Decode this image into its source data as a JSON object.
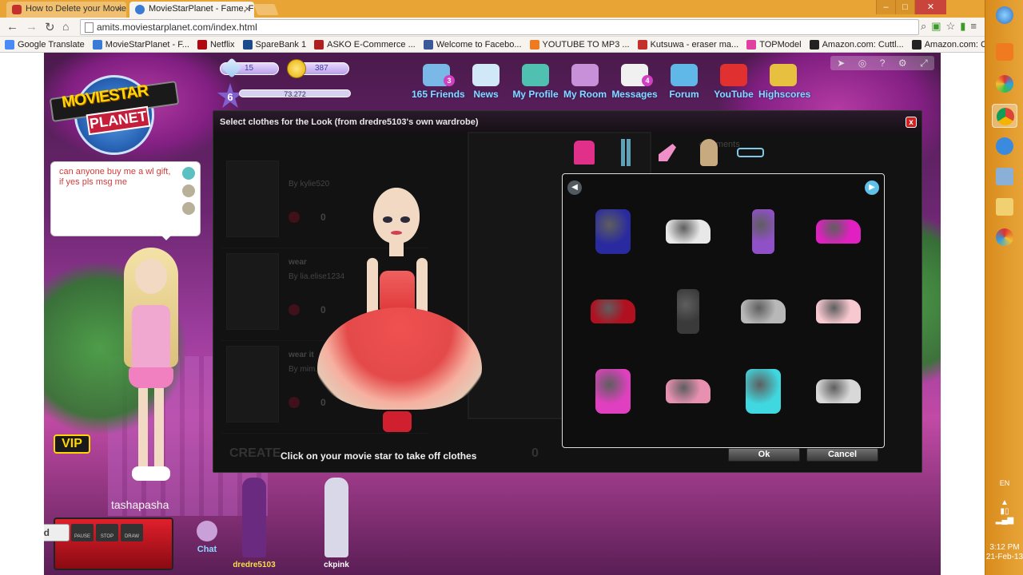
{
  "browser": {
    "tabs": [
      {
        "title": "How to Delete your Movie",
        "favicon_color": "#c4302b"
      },
      {
        "title": "MovieStarPlanet - Fame, F",
        "favicon_color": "#3a7bd5"
      }
    ],
    "url": "amits.moviestarplanet.com/index.html",
    "bookmarks": [
      {
        "label": "Google Translate",
        "color": "#4a8af4"
      },
      {
        "label": "MovieStarPlanet - F...",
        "color": "#3a7bd5"
      },
      {
        "label": "Netflix",
        "color": "#b00710"
      },
      {
        "label": "SpareBank 1",
        "color": "#1a4a8a"
      },
      {
        "label": "ASKO E-Commerce ...",
        "color": "#b02020"
      },
      {
        "label": "Welcome to Facebo...",
        "color": "#3b5998"
      },
      {
        "label": "YOUTUBE TO MP3 ...",
        "color": "#f07a20"
      },
      {
        "label": "Kutsuwa - eraser ma...",
        "color": "#c4302b"
      },
      {
        "label": "TOPModel",
        "color": "#e040a0"
      },
      {
        "label": "Amazon.com: Cuttl...",
        "color": "#222222"
      },
      {
        "label": "Amazon.com: Cuttl...",
        "color": "#222222"
      }
    ]
  },
  "game": {
    "logo": {
      "line1": "MOVIESTAR",
      "line2": "PLANET"
    },
    "stats": {
      "diamonds": "15",
      "starcoins": "387",
      "level": "6",
      "fame": "73.272"
    },
    "nav": [
      {
        "label": "165 Friends",
        "badge": "3",
        "color": "#7ab8e8"
      },
      {
        "label": "News",
        "badge": "",
        "color": "#d0e8f8"
      },
      {
        "label": "My Profile",
        "badge": "",
        "color": "#50c0b0"
      },
      {
        "label": "My Room",
        "badge": "",
        "color": "#c890d8"
      },
      {
        "label": "Messages",
        "badge": "4",
        "color": "#f0f0f0"
      },
      {
        "label": "Forum",
        "badge": "",
        "color": "#60b8e8"
      },
      {
        "label": "YouTube",
        "badge": "",
        "color": "#e03030"
      },
      {
        "label": "Highscores",
        "badge": "",
        "color": "#e8c040"
      }
    ],
    "chat_bubble": "can anyone buy me a wl gift, if yes pls msg me",
    "vip": "VIP",
    "username": "tashapasha",
    "chat_label": "Chat",
    "friends": [
      {
        "name": "dredre5103",
        "color": "#6a2a80",
        "name_color": "#f4e04a"
      },
      {
        "name": "ckpink",
        "color": "#d8d8e8",
        "name_color": "#ffffff"
      }
    ],
    "recorder": {
      "brand": "ezvid",
      "buttons": [
        "PAUSE",
        "STOP",
        "DRAW"
      ]
    }
  },
  "modal": {
    "title": "Select clothes for the Look (from dredre5103's own wardrobe)",
    "close": "x",
    "hint": "Click on your movie star to take off clothes",
    "ok": "Ok",
    "cancel": "Cancel",
    "background_list": [
      {
        "title": "",
        "by": "By kylie520",
        "count": "0"
      },
      {
        "title": "wear",
        "by": "By lia.elise1234",
        "count": "0"
      },
      {
        "title": "wear it",
        "by": "By mim...",
        "count": "0"
      }
    ],
    "background_footer": "CREATE",
    "background_footer_count": "0",
    "background_comments": "comments",
    "categories": [
      "tops",
      "pants",
      "shoes",
      "hair",
      "accessories"
    ],
    "items": [
      {
        "name": "blue-fur-top",
        "color": "#2a2aa0"
      },
      {
        "name": "white-sneakers",
        "color": "#e8e8e8"
      },
      {
        "name": "purple-boots",
        "color": "#9050c8"
      },
      {
        "name": "pink-heels",
        "color": "#e020c0"
      },
      {
        "name": "red-shoes",
        "color": "#b01020"
      },
      {
        "name": "black-boots",
        "color": "#3a3a3a"
      },
      {
        "name": "grey-sneakers",
        "color": "#b8b8b8"
      },
      {
        "name": "pink-glow-shoes",
        "color": "#f8c8d0"
      },
      {
        "name": "pink-blue-fur-skirt",
        "color": "#e040c0"
      },
      {
        "name": "pink-trainers",
        "color": "#e890b0"
      },
      {
        "name": "aqua-fur-skirt",
        "color": "#40d8e0"
      },
      {
        "name": "silver-sandals",
        "color": "#d8d8d8"
      }
    ]
  },
  "taskbar": {
    "language": "EN",
    "time": "3:12 PM",
    "date": "21-Feb-13"
  }
}
